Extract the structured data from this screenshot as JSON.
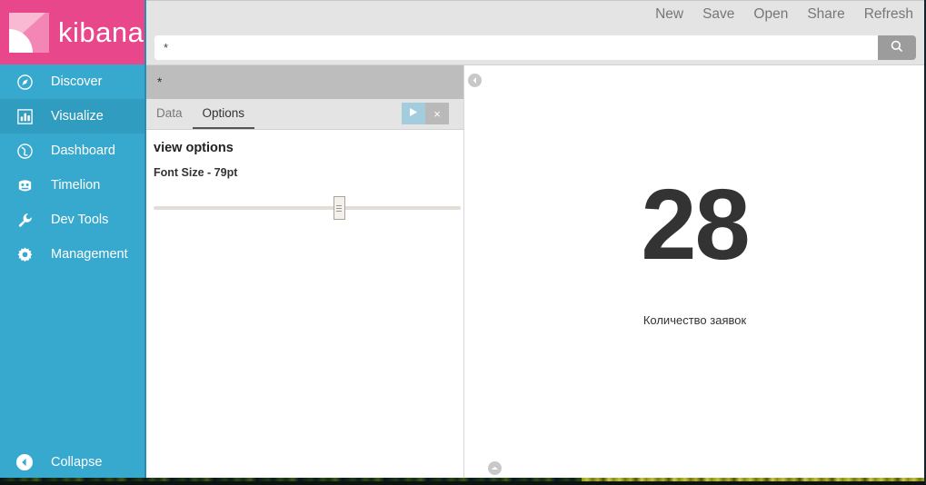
{
  "brand": {
    "name": "kibana",
    "logo_icon": "kibana-k-logo",
    "color": "#e8488b"
  },
  "sidebar": {
    "background_color": "#37a9cf",
    "active_color": "#2f9cc0",
    "items": [
      {
        "label": "Discover",
        "icon": "compass-icon",
        "active": false
      },
      {
        "label": "Visualize",
        "icon": "bar-chart-icon",
        "active": true
      },
      {
        "label": "Dashboard",
        "icon": "globe-icon",
        "active": false
      },
      {
        "label": "Timelion",
        "icon": "timelion-icon",
        "active": false
      },
      {
        "label": "Dev Tools",
        "icon": "wrench-icon",
        "active": false
      },
      {
        "label": "Management",
        "icon": "gear-icon",
        "active": false
      }
    ],
    "collapse": {
      "label": "Collapse",
      "icon": "chevron-left-circle-icon"
    }
  },
  "topbar": {
    "links": [
      {
        "label": "New"
      },
      {
        "label": "Save"
      },
      {
        "label": "Open"
      },
      {
        "label": "Share"
      },
      {
        "label": "Refresh"
      }
    ],
    "query": {
      "value": "*",
      "placeholder": "Search...",
      "submit_icon": "search-icon"
    }
  },
  "editor": {
    "panel_header": "*",
    "tabs": [
      {
        "label": "Data",
        "active": false
      },
      {
        "label": "Options",
        "active": true
      }
    ],
    "actions": {
      "apply_icon": "play-triangle-icon",
      "apply_color": "#a3cddd",
      "discard_icon": "close-x-icon",
      "discard_label": "×",
      "discard_color": "#b9b9b9"
    },
    "options": {
      "title": "view options",
      "font_size_label": "Font Size - 79pt",
      "font_size_value": 79,
      "slider": {
        "min": 12,
        "max": 120,
        "value": 79,
        "handle_percent": 60.5,
        "track_color": "#e2ddd5"
      }
    },
    "collapse_icon": "chevron-left-circle-icon"
  },
  "visualization": {
    "type": "metric",
    "value": "28",
    "label": "Количество заявок",
    "value_color": "#333333",
    "expand_icon": "chevron-up-circle-icon"
  },
  "chart_data": {
    "type": "table",
    "title": "",
    "categories": [
      "Количество заявок"
    ],
    "values": [
      28
    ],
    "xlabel": "",
    "ylabel": ""
  }
}
